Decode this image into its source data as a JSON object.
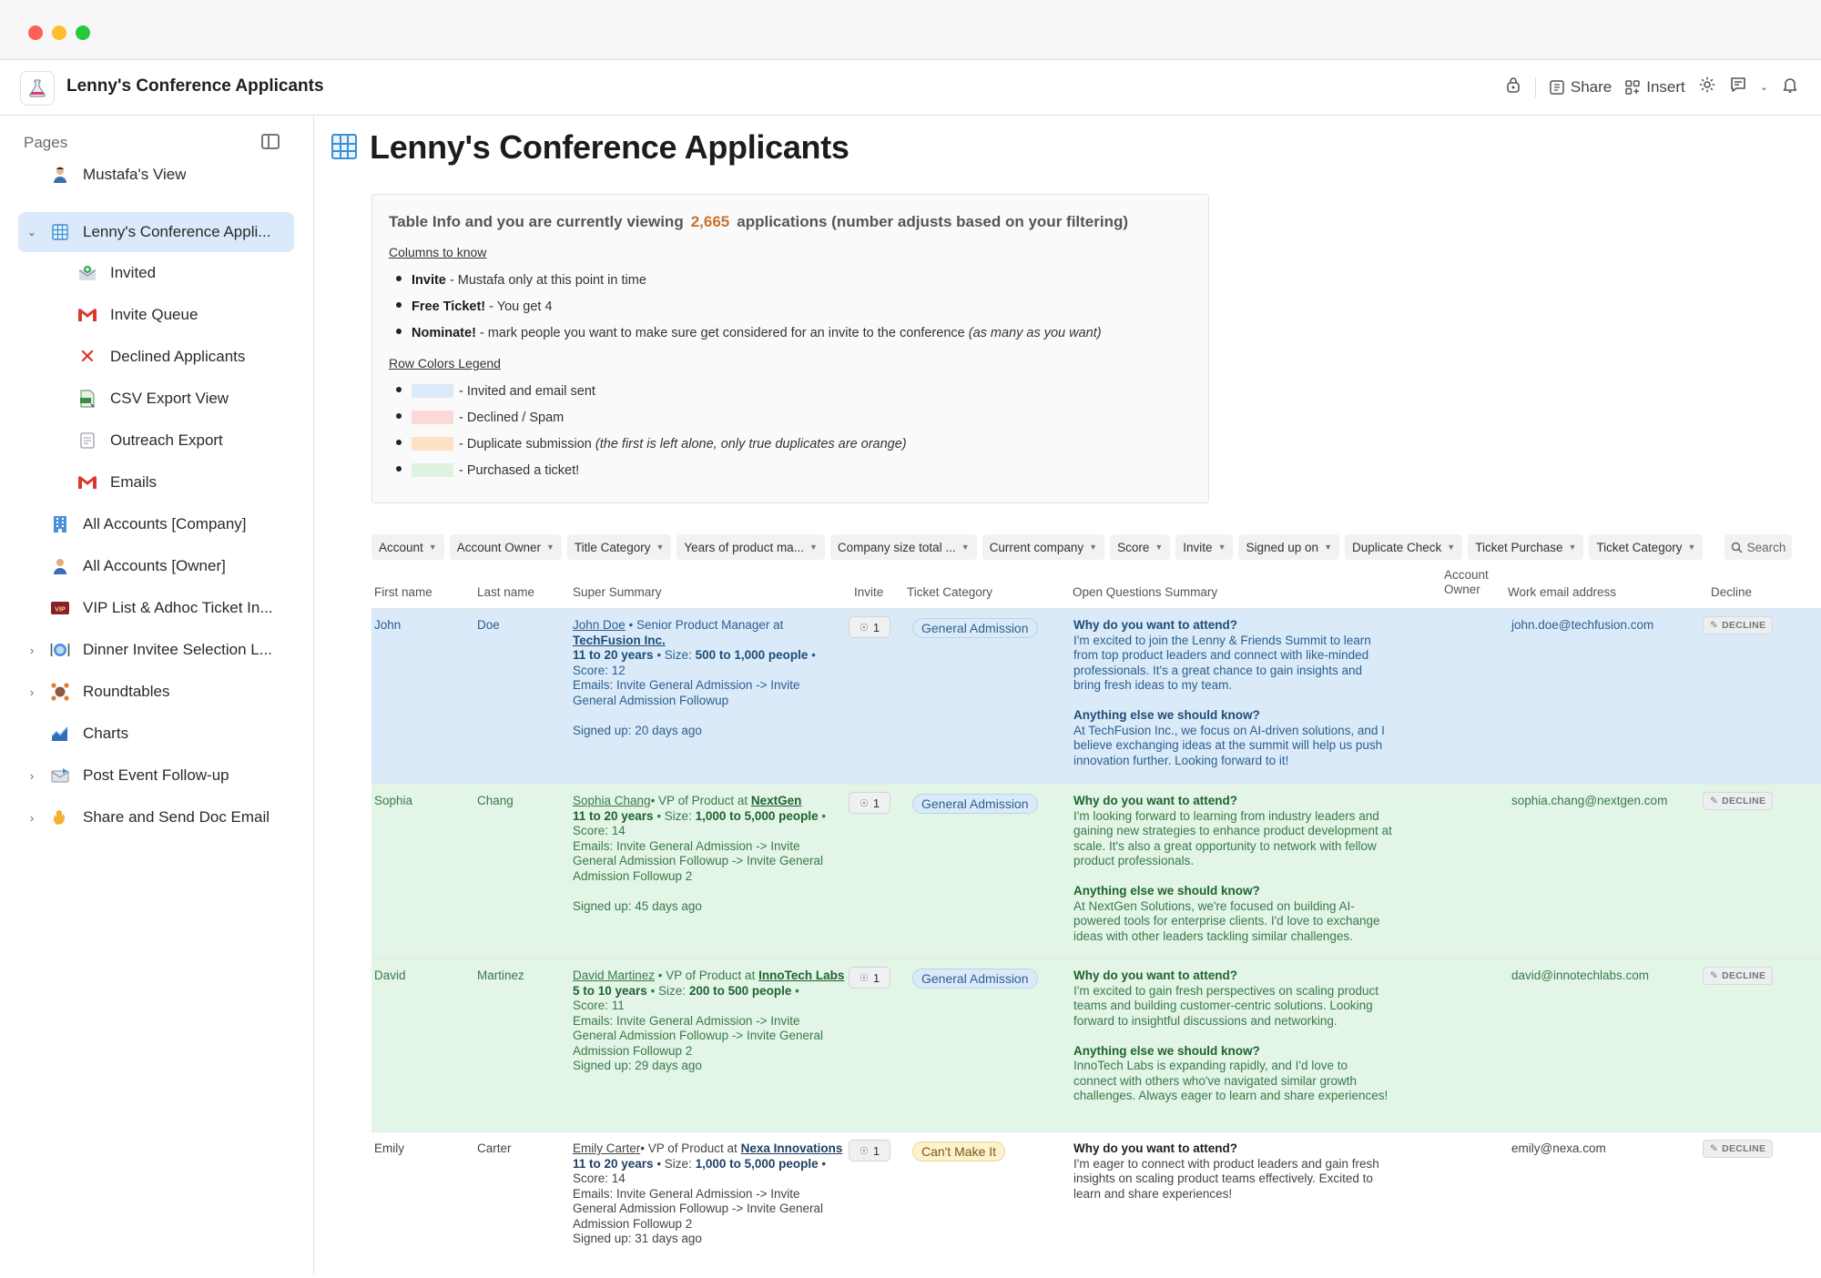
{
  "window": {
    "title": "Lenny's Conference Applicants"
  },
  "toolbar": {
    "share": "Share",
    "insert": "Insert"
  },
  "sidebar": {
    "header": "Pages",
    "items": [
      {
        "label": "Mustafa's View",
        "icon": "person-icon"
      },
      {
        "label": "Lenny's Conference Appli...",
        "icon": "table-icon",
        "active": true
      },
      {
        "label": "Invited",
        "icon": "invited-icon"
      },
      {
        "label": "Invite Queue",
        "icon": "gmail-icon"
      },
      {
        "label": "Declined Applicants",
        "icon": "x-icon"
      },
      {
        "label": "CSV Export View",
        "icon": "csv-icon"
      },
      {
        "label": "Outreach Export",
        "icon": "doc-icon"
      },
      {
        "label": "Emails",
        "icon": "gmail-icon"
      },
      {
        "label": "All Accounts [Company]",
        "icon": "building-icon"
      },
      {
        "label": "All Accounts [Owner]",
        "icon": "person-icon"
      },
      {
        "label": "VIP List & Adhoc Ticket In...",
        "icon": "vip-icon"
      },
      {
        "label": "Dinner Invitee Selection L...",
        "icon": "dinner-icon"
      },
      {
        "label": "Roundtables",
        "icon": "roundtable-icon"
      },
      {
        "label": "Charts",
        "icon": "chart-icon"
      },
      {
        "label": "Post Event Follow-up",
        "icon": "mail-icon"
      },
      {
        "label": "Share and Send Doc Email",
        "icon": "hand-icon"
      }
    ]
  },
  "page": {
    "title": "Lenny's Conference Applicants"
  },
  "info": {
    "head_pre": "Table Info and you are currently viewing",
    "count": "2,665",
    "head_post": "applications (number adjusts based on your filtering)",
    "columns_title": "Columns to know",
    "col1_b": "Invite",
    "col1": " - Mustafa only at this point in time",
    "col2_b": "Free Ticket!",
    "col2": " - You get 4",
    "col3_b": "Nominate!",
    "col3": " - mark people you want to make sure get considered for an invite to the conference ",
    "col3_i": "(as many as you want)",
    "legend_title": "Row Colors Legend",
    "legend1": "- Invited and email sent",
    "legend2": "- Declined / Spam",
    "legend3": "- Duplicate submission ",
    "legend3_i": "(the first is left alone, only true duplicates are orange)",
    "legend4": "- Purchased a ticket!",
    "colors": {
      "invited": "#dbeaf8",
      "declined": "#fbd9d6",
      "duplicate": "#fde2c8",
      "purchased": "#dff3e3"
    }
  },
  "filters": [
    "Account",
    "Account Owner",
    "Title Category",
    "Years of product ma...",
    "Company size total ...",
    "Current company",
    "Score",
    "Invite",
    "Signed up on",
    "Duplicate Check",
    "Ticket Purchase",
    "Ticket Category"
  ],
  "search": "Search",
  "columns": {
    "first": "First name",
    "last": "Last name",
    "summary": "Super Summary",
    "invite": "Invite",
    "ticket": "Ticket Category",
    "questions": "Open Questions Summary",
    "owner": "Account Owner",
    "email": "Work email address",
    "decline": "Decline"
  },
  "q1": "Why do you want to attend?",
  "q2": "Anything else we should know?",
  "decline_label": "DECLINE",
  "rows": [
    {
      "first": "John",
      "last": "Doe",
      "name_link": "John Doe",
      "title_text": " • Senior Product Manager at",
      "company": "TechFusion Inc.",
      "years": "11 to 20 years",
      "size_pre": " • Size: ",
      "size": "500 to 1,000 people",
      "size_post": " •",
      "score": "Score: 12",
      "emails": "Emails: Invite General Admission -> Invite General Admission Followup",
      "signed": "Signed up: 20 days ago",
      "invite": "1",
      "ticket": "General Admission",
      "a1": "I'm excited to join the Lenny & Friends Summit to learn from top product leaders and connect with like-minded professionals. It's a great chance to gain insights and bring fresh ideas to my team.",
      "a2": "At TechFusion Inc., we focus on AI-driven solutions, and I believe exchanging ideas at the summit will help us push innovation further. Looking forward to it!",
      "email": "john.doe@techfusion.com"
    },
    {
      "first": "Sophia",
      "last": "Chang",
      "name_link": "Sophia Chang",
      "title_text": "• VP of Product at",
      "company": "NextGen",
      "years": "11 to 20 years",
      "size_pre": " • Size: ",
      "size": "1,000 to 5,000 people",
      "size_post": " •",
      "score": "Score: 14",
      "emails": "Emails: Invite General Admission -> Invite General Admission Followup -> Invite General Admission Followup 2",
      "signed": "Signed up: 45 days ago",
      "invite": "1",
      "ticket": "General Admission",
      "a1": "I'm looking forward to learning from industry leaders and gaining new strategies to enhance product development at scale. It's also a great opportunity to network with fellow product professionals.",
      "a2": "At NextGen Solutions, we're focused on building AI-powered tools for enterprise clients. I'd love to exchange ideas with other leaders tackling similar challenges.",
      "email": "sophia.chang@nextgen.com"
    },
    {
      "first": "David",
      "last": "Martinez",
      "name_link": "David Martinez",
      "title_text": " • VP of Product at",
      "company": "InnoTech Labs",
      "years": "5 to 10 years",
      "size_pre": " • Size: ",
      "size": "200 to 500 people",
      "size_post": " •",
      "score": "Score: 11",
      "emails": "Emails: Invite General Admission -> Invite General Admission Followup -> Invite General Admission Followup 2",
      "signed": "Signed up: 29 days ago",
      "invite": "1",
      "ticket": "General Admission",
      "a1": "I'm excited to gain fresh perspectives on scaling product teams and building customer-centric solutions. Looking forward to insightful discussions and networking.",
      "a2": "InnoTech Labs is expanding rapidly, and I'd love to connect with others who've navigated similar growth challenges. Always eager to learn and share experiences!",
      "email": "david@innotechlabs.com"
    },
    {
      "first": "Emily",
      "last": "Carter",
      "name_link": "Emily Carter",
      "title_text": "• VP of Product at",
      "company": "Nexa Innovations",
      "years": "11 to 20 years",
      "size_pre": " • Size: ",
      "size": "1,000 to 5,000 people",
      "size_post": " •",
      "score": "Score: 14",
      "emails": "Emails: Invite General Admission -> Invite General Admission Followup -> Invite General Admission Followup 2",
      "signed": "Signed up: 31 days ago",
      "invite": "1",
      "ticket": "Can't Make It",
      "a1": "I'm eager to connect with product leaders and gain fresh insights on scaling product teams effectively. Excited to learn and share experiences!",
      "a2": "",
      "email": "emily@nexa.com"
    }
  ]
}
